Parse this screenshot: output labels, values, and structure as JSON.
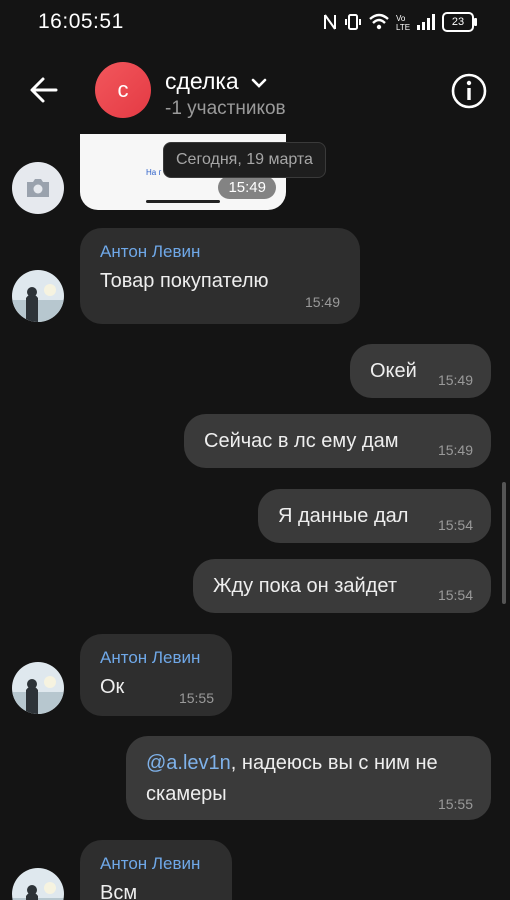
{
  "status_bar": {
    "time": "16:05:51",
    "battery": "23"
  },
  "header": {
    "avatar_letter": "с",
    "title": "сделка",
    "subtitle": "-1 участников"
  },
  "date_pill": "Сегодня, 19 марта",
  "image_message": {
    "text": "На г",
    "time": "15:49"
  },
  "messages": [
    {
      "sender": "Антон Левин",
      "text": "Товар покупателю",
      "time": "15:49"
    },
    {
      "text": "Окей",
      "time": "15:49"
    },
    {
      "text": "Сейчас в лс ему дам",
      "time": "15:49"
    },
    {
      "text": "Я данные дал",
      "time": "15:54"
    },
    {
      "text": "Жду пока он зайдет",
      "time": "15:54"
    },
    {
      "sender": "Антон Левин",
      "text": "Ок",
      "time": "15:55"
    },
    {
      "mention": "@a.lev1n",
      "text": ", надеюсь вы с ним не",
      "text2": "скамеры",
      "time": "15:55"
    },
    {
      "sender": "Антон Левин",
      "text": "Всм"
    }
  ],
  "colors": {
    "accent_link": "#6fa8e8",
    "avatar_red": "#e43a44",
    "background": "#141414"
  },
  "icons": [
    "back-arrow-icon",
    "chevron-down-icon",
    "info-icon",
    "camera-icon",
    "wifi-icon",
    "signal-icon",
    "battery-icon"
  ]
}
